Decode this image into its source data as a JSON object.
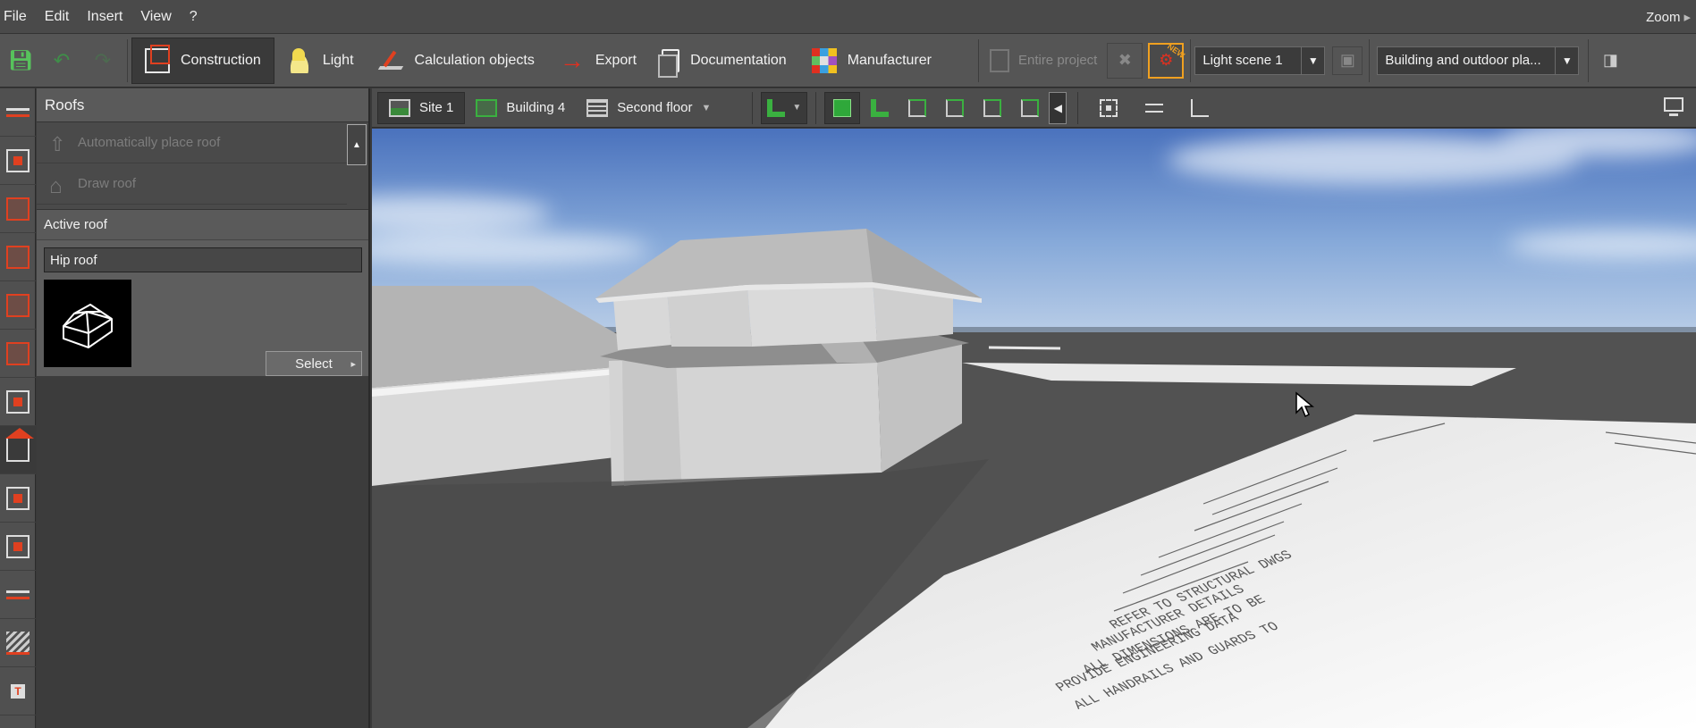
{
  "menu": {
    "items": [
      "File",
      "Edit",
      "Insert",
      "View",
      "?"
    ],
    "zoom_label": "Zoom"
  },
  "toolbar": {
    "tabs": {
      "construction": "Construction",
      "light": "Light",
      "calculation_objects": "Calculation objects",
      "export": "Export",
      "documentation": "Documentation",
      "manufacturer": "Manufacturer"
    },
    "entire_project": "Entire project",
    "light_scene": "Light scene 1",
    "view_mode": "Building and outdoor pla..."
  },
  "side_panel": {
    "title": "Roofs",
    "actions": [
      "Automatically place roof",
      "Draw roof"
    ],
    "active_roof_heading": "Active roof",
    "active_roof_name": "Hip roof",
    "select_label": "Select"
  },
  "view_toolbar": {
    "site": "Site 1",
    "building": "Building 4",
    "floor": "Second floor"
  },
  "plan_notes": [
    "ALL HANDRAILS AND GUARDS TO",
    "PROVIDE ENGINEERING DATA",
    "ALL DIMENSIONS ARE TO BE",
    "MANUFACTURER DETAILS",
    "REFER TO STRUCTURAL DWGS"
  ],
  "colors": {
    "accent_red": "#e04020",
    "accent_green": "#3ab040",
    "new_badge": "#f0a020"
  }
}
